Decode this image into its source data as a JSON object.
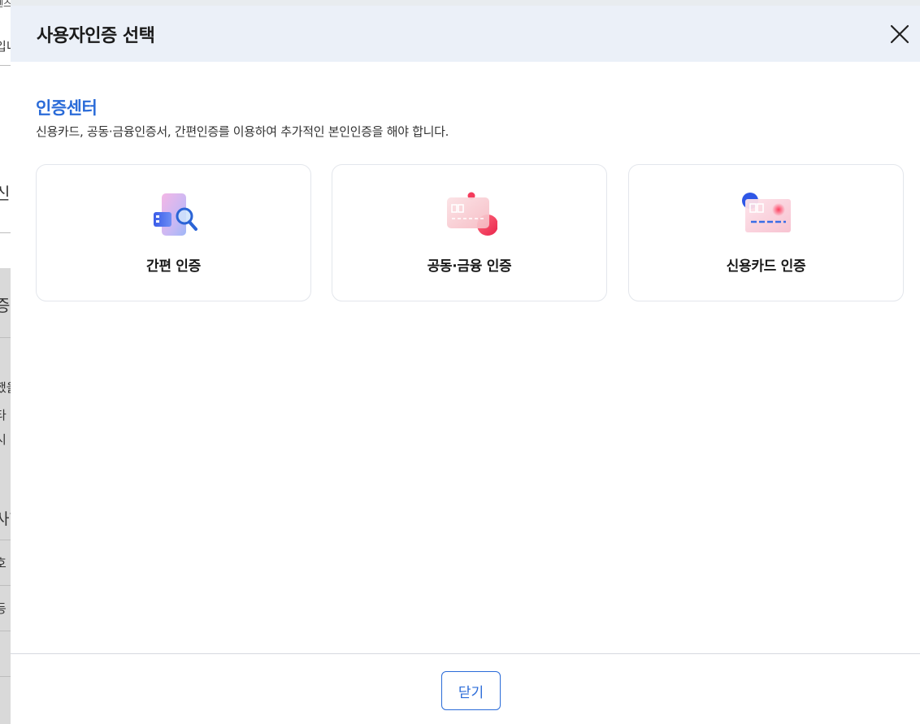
{
  "background": {
    "fragments": [
      "렌스",
      "입니",
      "신",
      "증",
      "했을",
      "타",
      "시",
      "사항",
      "호",
      "등"
    ]
  },
  "modal": {
    "title": "사용자인증 선택",
    "close_icon": "close-icon",
    "section": {
      "title": "인증센터",
      "description": "신용카드, 공동·금융인증서, 간편인증를 이용하여 추가적인 본인인증을 해야 합니다."
    },
    "options": [
      {
        "label": "간편 인증",
        "icon": "simple-auth-icon"
      },
      {
        "label": "공동·금융 인증",
        "icon": "certificate-auth-icon"
      },
      {
        "label": "신용카드 인증",
        "icon": "credit-card-auth-icon"
      }
    ],
    "footer": {
      "close_label": "닫기"
    }
  },
  "colors": {
    "accent": "#2a6bd8",
    "header_bg": "#ebf0f8"
  }
}
